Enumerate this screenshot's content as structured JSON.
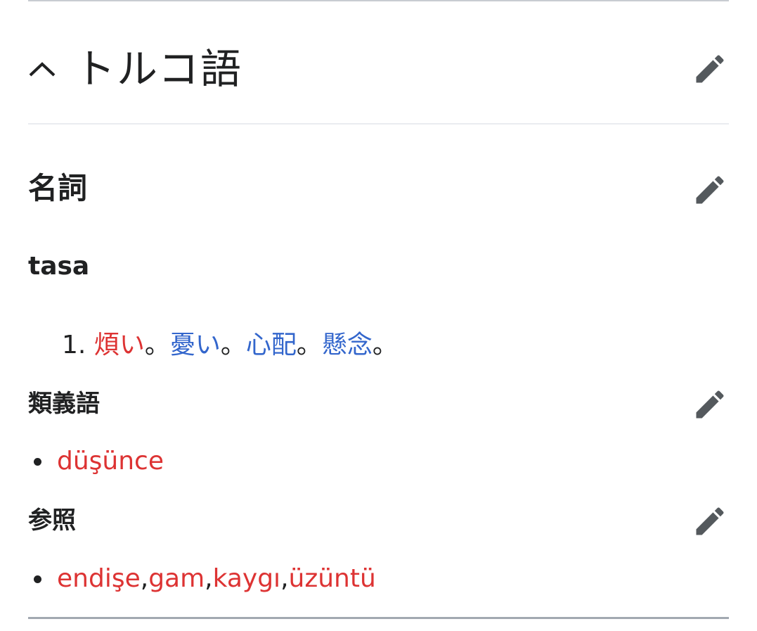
{
  "section": {
    "title": "トルコ語",
    "expanded": true,
    "toggle_icon": "chevron-up-icon",
    "edit_icon": "pencil-icon"
  },
  "pos": {
    "title": "名詞"
  },
  "headword": "tasa",
  "definitions": [
    {
      "number": "1.",
      "parts": [
        {
          "text": "煩い",
          "link": "red"
        },
        {
          "text": "。",
          "link": "none"
        },
        {
          "text": "憂い",
          "link": "blue"
        },
        {
          "text": "。",
          "link": "none"
        },
        {
          "text": "心配",
          "link": "blue"
        },
        {
          "text": "。",
          "link": "none"
        },
        {
          "text": "懸念",
          "link": "blue"
        },
        {
          "text": "。",
          "link": "none"
        }
      ]
    }
  ],
  "synonyms": {
    "title": "類義語",
    "items": [
      "düşünce"
    ]
  },
  "see_also": {
    "title": "参照",
    "items": [
      "endişe",
      "gam",
      "kaygı",
      "üzüntü"
    ],
    "separator": ", "
  },
  "colors": {
    "red_link": "#dd3333",
    "blue_link": "#3366cc",
    "text": "#202122",
    "icon": "#54595d"
  }
}
